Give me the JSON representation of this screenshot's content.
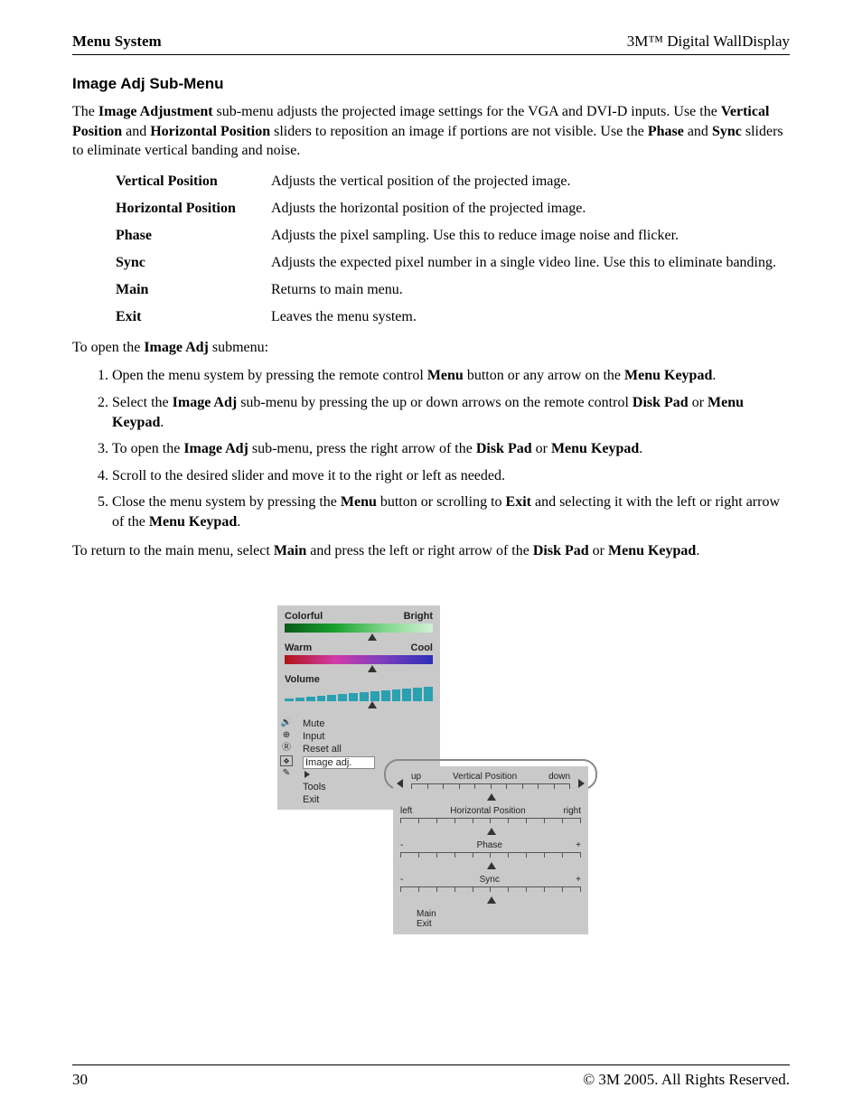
{
  "header": {
    "left": "Menu System",
    "right": "3M™ Digital WallDisplay"
  },
  "title": "Image Adj Sub-Menu",
  "intro": {
    "pre": "The ",
    "b1": "Image Adjustment",
    "mid1": " sub-menu adjusts the projected image settings for the VGA and DVI-D inputs. Use the ",
    "b2": "Vertical Position",
    "mid2": " and ",
    "b3": "Horizontal Position",
    "mid3": " sliders to reposition an image if portions are not visible. Use the ",
    "b4": "Phase",
    "mid4": " and ",
    "b5": "Sync",
    "post": " sliders to eliminate vertical banding and noise."
  },
  "defs": [
    {
      "term": "Vertical Position",
      "desc": "Adjusts the vertical position of the projected image."
    },
    {
      "term": "Horizontal Position",
      "desc": "Adjusts the horizontal position of the projected image."
    },
    {
      "term": "Phase",
      "desc": "Adjusts the pixel sampling. Use this to reduce image noise and flicker."
    },
    {
      "term": "Sync",
      "desc": "Adjusts the expected pixel number in a single video line. Use this to eliminate banding."
    },
    {
      "term": "Main",
      "desc": "Returns to main menu."
    },
    {
      "term": "Exit",
      "desc": "Leaves the menu system."
    }
  ],
  "open_lead": {
    "pre": "To open the ",
    "b": "Image Adj",
    "post": " submenu:"
  },
  "steps": {
    "s1": {
      "a": "Open the menu system by pressing the remote control ",
      "b1": "Menu",
      "mid": " button or any arrow on the ",
      "b2": "Menu Keypad",
      "end": "."
    },
    "s2": {
      "a": "Select the ",
      "b1": "Image Adj",
      "mid1": " sub-menu by pressing the up or down arrows on the remote control ",
      "b2": "Disk Pad",
      "mid2": " or ",
      "b3": "Menu Keypad",
      "end": "."
    },
    "s3": {
      "a": "To open the ",
      "b1": "Image Adj",
      "mid1": " sub-menu, press the right arrow of the ",
      "b2": "Disk Pad",
      "mid2": " or ",
      "b3": "Menu Keypad",
      "end": "."
    },
    "s4": "Scroll to the desired slider and move it to the right or left as needed.",
    "s5": {
      "a": "Close the menu system by pressing the ",
      "b1": "Menu",
      "mid1": " button or scrolling to ",
      "b2": "Exit",
      "mid2": " and selecting it with the left or right arrow of the ",
      "b3": "Menu Keypad",
      "end": "."
    }
  },
  "return_line": {
    "a": "To return to the main menu, select ",
    "b1": "Main",
    "mid1": " and press the left or right arrow of the ",
    "b2": "Disk Pad",
    "mid2": " or ",
    "b3": "Menu Keypad",
    "end": "."
  },
  "osd": {
    "colorful": "Colorful",
    "bright": "Bright",
    "warm": "Warm",
    "cool": "Cool",
    "volume": "Volume",
    "menu": {
      "mute": "Mute",
      "input": "Input",
      "reset": "Reset all",
      "imageadj": "Image adj.",
      "tools": "Tools",
      "exit": "Exit"
    },
    "sub": {
      "up": "up",
      "down": "down",
      "vpos": "Vertical Position",
      "left": "left",
      "right": "right",
      "hpos": "Horizontal Position",
      "phase": "Phase",
      "sync": "Sync",
      "minus": "-",
      "plus": "+",
      "main": "Main",
      "exit": "Exit"
    }
  },
  "footer": {
    "page": "30",
    "copyright": "© 3M 2005. All Rights Reserved."
  }
}
